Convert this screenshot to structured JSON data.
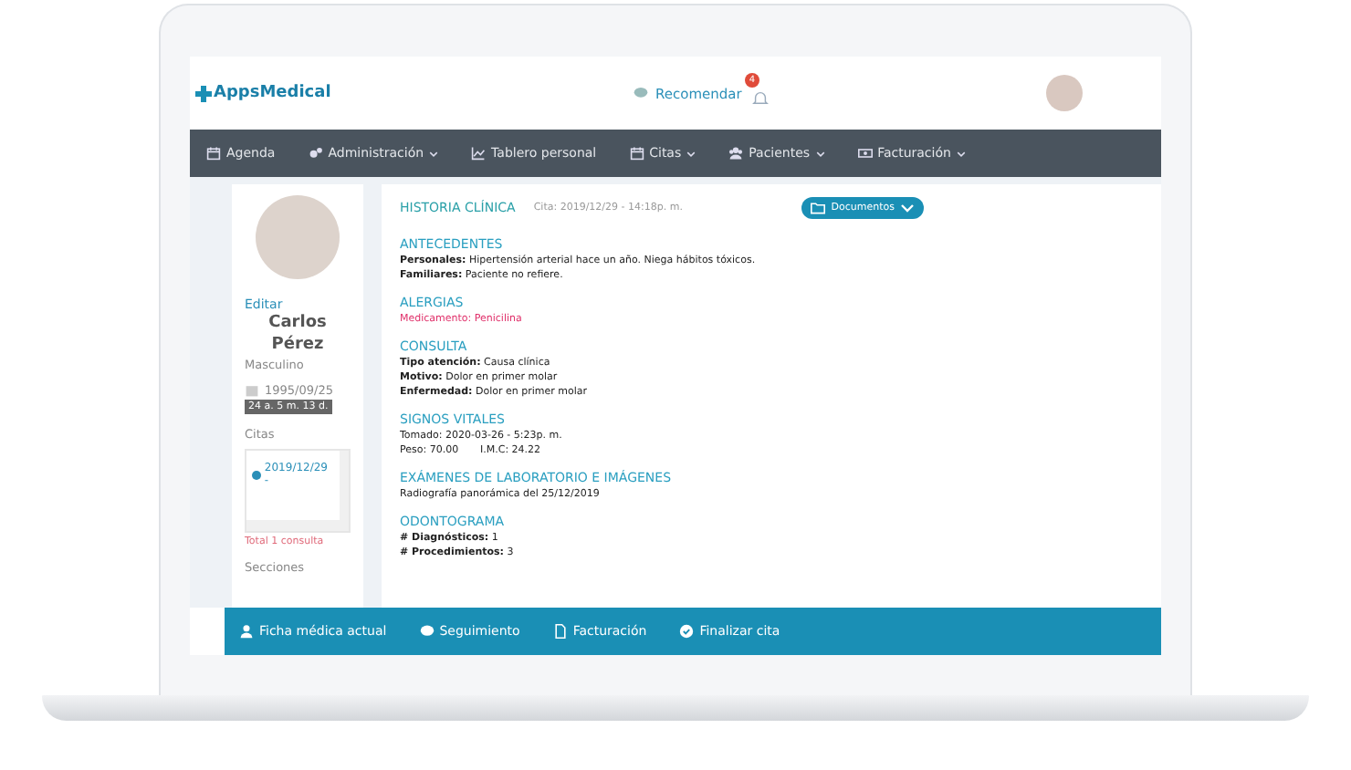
{
  "header": {
    "logo": "AppsMedical",
    "recommend": "Recomendar",
    "notification_count": "4"
  },
  "nav": [
    {
      "label": "Agenda",
      "dropdown": false
    },
    {
      "label": "Administración",
      "dropdown": true
    },
    {
      "label": "Tablero personal",
      "dropdown": false
    },
    {
      "label": "Citas",
      "dropdown": true
    },
    {
      "label": "Pacientes",
      "dropdown": true
    },
    {
      "label": "Facturación",
      "dropdown": true
    }
  ],
  "patient": {
    "edit": "Editar",
    "first_name": "Carlos",
    "last_name": "Pérez",
    "sex": "Masculino",
    "birth_date": "1995/09/25",
    "age": "24 a. 5 m. 13 d."
  },
  "citas": {
    "title": "Citas",
    "items": [
      "2019/12/29 -"
    ],
    "total": "Total 1 consulta"
  },
  "sections_label": "Secciones",
  "record": {
    "title": "HISTORIA CLÍNICA",
    "date": "Cita: 2019/12/29 - 14:18p. m.",
    "documents_button": "Documentos"
  },
  "sections": [
    {
      "title": "ANTECEDENTES",
      "lines": [
        {
          "kind": "labeled",
          "label": "Personales:",
          "value": "Hipertensión arterial hace un año. Niega hábitos tóxicos."
        },
        {
          "kind": "labeled",
          "label": "Familiares:",
          "value": "Paciente no refiere."
        }
      ]
    },
    {
      "title": "ALERGIAS",
      "lines": [
        {
          "kind": "alert",
          "value": "Medicamento: Penicilina"
        }
      ]
    },
    {
      "title": "CONSULTA",
      "lines": [
        {
          "kind": "labeled",
          "label": "Tipo atención:",
          "value": "Causa clínica"
        },
        {
          "kind": "labeled",
          "label": "Motivo:",
          "value": "Dolor en primer molar"
        },
        {
          "kind": "labeled",
          "label": "Enfermedad:",
          "value": "Dolor en primer molar"
        }
      ]
    },
    {
      "title": "SIGNOS VITALES",
      "lines": [
        {
          "kind": "plain",
          "value": "Tomado: 2020-03-26 - 5:23p. m."
        },
        {
          "kind": "pair",
          "value": "Peso: 70.00",
          "value_2": "I.M.C: 24.22"
        }
      ]
    },
    {
      "title": "EXÁMENES DE LABORATORIO E IMÁGENES",
      "lines": [
        {
          "kind": "plain",
          "value": "Radiografía panorámica del 25/12/2019"
        }
      ]
    },
    {
      "title": "ODONTOGRAMA",
      "lines": [
        {
          "kind": "labeled",
          "label": "# Diagnósticos:",
          "value": "1"
        },
        {
          "kind": "labeled",
          "label": "# Procedimientos:",
          "value": "3"
        }
      ]
    }
  ],
  "actions": [
    {
      "label": "Ficha médica actual"
    },
    {
      "label": "Seguimiento"
    },
    {
      "label": "Facturación"
    },
    {
      "label": "Finalizar cita"
    }
  ]
}
